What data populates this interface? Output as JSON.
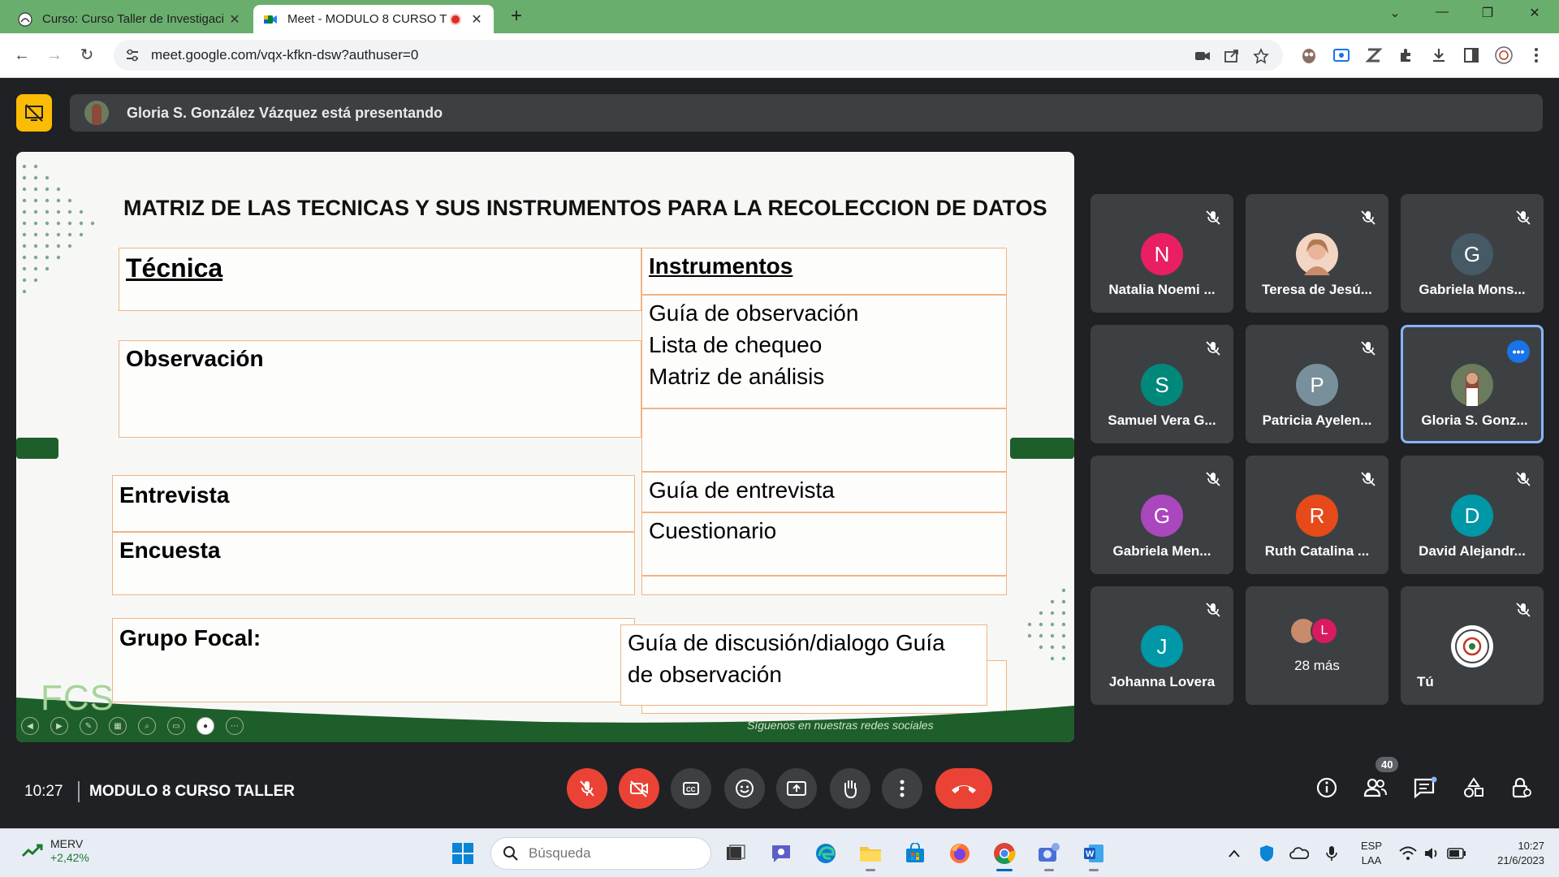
{
  "browser": {
    "tabs": [
      {
        "title": "Curso: Curso Taller de Investigaci"
      },
      {
        "title": "Meet - MODULO 8 CURSO T"
      }
    ],
    "url": "meet.google.com/vqx-kfkn-dsw?authuser=0"
  },
  "meet": {
    "presenting_text": "Gloria S. González Vázquez está presentando",
    "time": "10:27",
    "meeting_name": "MODULO 8 CURSO TALLER",
    "people_count": "40",
    "participants": [
      {
        "name": "Natalia Noemi ...",
        "initial": "N",
        "color": "#e91e63"
      },
      {
        "name": "Teresa de Jesú...",
        "initial": "",
        "color": "#c98b6b"
      },
      {
        "name": "Gabriela Mons...",
        "initial": "G",
        "color": "#455a64"
      },
      {
        "name": "Samuel Vera G...",
        "initial": "S",
        "color": "#00897b"
      },
      {
        "name": "Patricia Ayelen...",
        "initial": "P",
        "color": "#78909c"
      },
      {
        "name": "Gloria S. Gonz...",
        "initial": "",
        "color": "#6b7b5e"
      },
      {
        "name": "Gabriela Men...",
        "initial": "G",
        "color": "#ab47bc"
      },
      {
        "name": "Ruth Catalina ...",
        "initial": "R",
        "color": "#e64a19"
      },
      {
        "name": "David Alejandr...",
        "initial": "D",
        "color": "#0097a7"
      },
      {
        "name": "Johanna Lovera",
        "initial": "J",
        "color": "#0097a7"
      },
      {
        "name": "28 más",
        "initial": "L",
        "color": "#d81b60"
      },
      {
        "name": "Tú",
        "initial": "",
        "color": "#ffffff"
      }
    ]
  },
  "slide": {
    "title": "MATRIZ  DE LAS TECNICAS  Y SUS INSTRUMENTOS PARA LA RECOLECCION DE DATOS",
    "col_tecnica": "Técnica",
    "col_instrumentos": "Instrumentos",
    "observacion": "Observación",
    "obs_instr_1": "Guía de observación",
    "obs_instr_2": "Lista de chequeo",
    "obs_instr_3": "Matriz de análisis",
    "entrevista": "Entrevista",
    "entrevista_instr": "Guía de entrevista",
    "encuesta": "Encuesta",
    "encuesta_instr": "Cuestionario",
    "grupo_focal": "Grupo Focal:",
    "grupo_instr_1": "Guía de  discusión/dialogo Guía",
    "grupo_instr_2": "de observación",
    "logo": "FCS",
    "social": "Síguenos en nuestras redes sociales"
  },
  "taskbar": {
    "stock_name": "MERV",
    "stock_change": "+2,42%",
    "search_placeholder": "Búsqueda",
    "lang_1": "ESP",
    "lang_2": "LAA",
    "time": "10:27",
    "date": "21/6/2023"
  }
}
